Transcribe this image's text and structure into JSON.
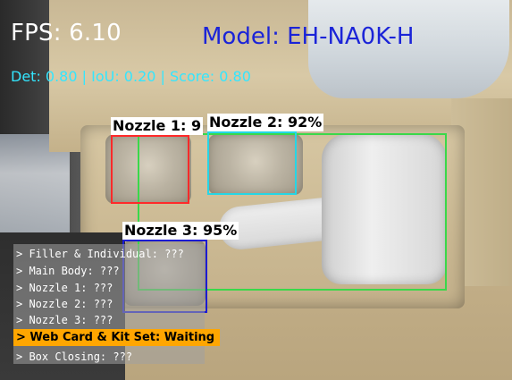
{
  "hud": {
    "fps": "FPS: 6.10",
    "model": "Model: EH-NA0K-H",
    "metrics": "Det: 0.80 | IoU: 0.20 | Score: 0.80"
  },
  "detections": [
    {
      "label": "Nozzle 1: 9",
      "color": "#ff2a2a"
    },
    {
      "label": "Nozzle 2: 92%",
      "color": "#25d6e6"
    },
    {
      "label": "Nozzle 3: 95%",
      "color": "#1b1bd3"
    },
    {
      "label": "",
      "color": "#3ad84a"
    }
  ],
  "checklist": {
    "items": [
      "> Filler & Individual: ???",
      "> Main Body: ???",
      "> Nozzle 1: ???",
      "> Nozzle 2: ???",
      "> Nozzle 3: ???",
      "> Web Card & Kit Set: Waiting",
      "> Box Closing: ???"
    ],
    "active_index": 5,
    "active_color": "#ffa600"
  }
}
